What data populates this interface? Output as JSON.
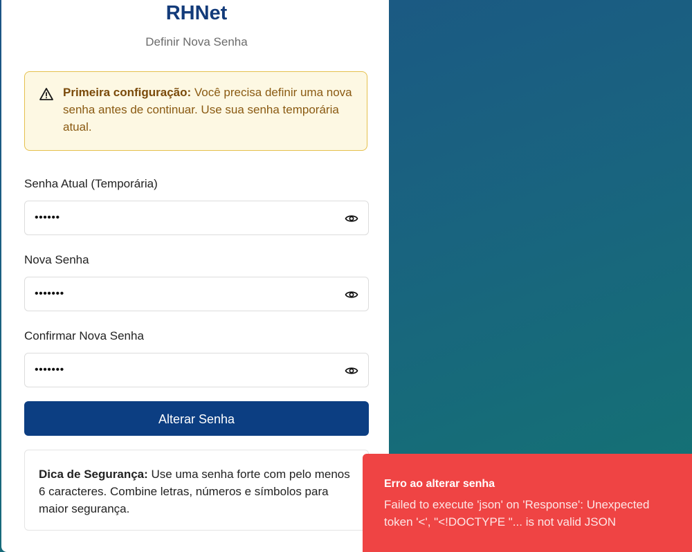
{
  "app": {
    "title": "RHNet",
    "subtitle": "Definir Nova Senha"
  },
  "alert": {
    "icon": "warning-icon",
    "strong": "Primeira configuração:",
    "text": " Você precisa definir uma nova senha antes de continuar. Use sua senha temporária atual."
  },
  "form": {
    "current_password": {
      "label": "Senha Atual (Temporária)",
      "value": "••••••",
      "icon": "eye-icon"
    },
    "new_password": {
      "label": "Nova Senha",
      "value": "•••••••",
      "icon": "eye-icon"
    },
    "confirm_password": {
      "label": "Confirmar Nova Senha",
      "value": "•••••••",
      "icon": "eye-icon"
    },
    "submit_label": "Alterar Senha"
  },
  "tip": {
    "strong": "Dica de Segurança:",
    "text": " Use uma senha forte com pelo menos 6 caracteres. Combine letras, números e símbolos para maior segurança."
  },
  "toast": {
    "title": "Erro ao alterar senha",
    "message": "Failed to execute 'json' on 'Response': Unexpected token '<', \"<!DOCTYPE \"... is not valid JSON"
  },
  "colors": {
    "brand": "#133b7a",
    "button": "#0c3e82",
    "alert_bg": "#fdf8e3",
    "alert_border": "#e5c04c",
    "toast_bg": "#ef4444"
  }
}
